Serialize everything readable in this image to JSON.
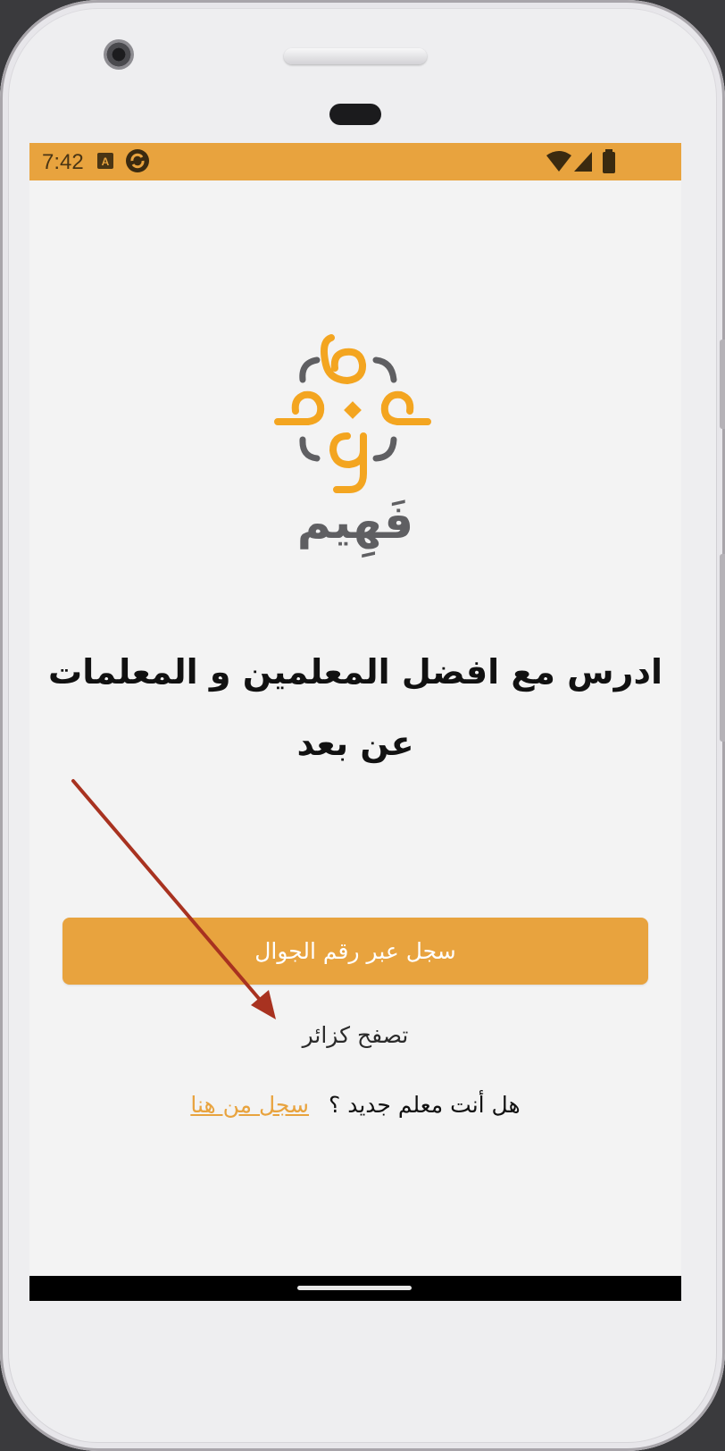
{
  "status_bar": {
    "time": "7:42",
    "background_color": "#e8a33e",
    "icons": [
      "a11y-app-icon",
      "sync-app-icon",
      "wifi-icon",
      "cellular-signal-icon",
      "battery-icon"
    ]
  },
  "logo": {
    "wordmark": "فَهِيم",
    "primary_color": "#f3a520",
    "secondary_color": "#5f5f62"
  },
  "headline": {
    "line1": "ادرس مع افضل المعلمين و المعلمات",
    "line2": "عن بعد"
  },
  "buttons": {
    "register_phone": "سجل عبر رقم الجوال",
    "browse_guest": "تصفح كزائر"
  },
  "teacher_prompt": {
    "question": "هل أنت معلم جديد ؟",
    "register_link": "سجل من هنا"
  },
  "annotation": {
    "arrow_color": "#a83220"
  },
  "colors": {
    "accent": "#e8a33e",
    "link": "#e8a33e",
    "text": "#111111"
  }
}
